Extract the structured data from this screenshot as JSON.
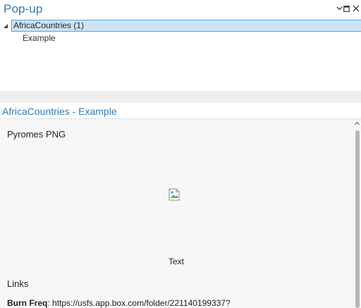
{
  "window": {
    "title": "Pop-up",
    "controls": {
      "dropdown_icon": "chevron-down-icon",
      "maximize_icon": "maximize-icon",
      "close_icon": "close-icon"
    }
  },
  "tree": {
    "parent": {
      "label": "AfricaCountries (1)",
      "expanded": true
    },
    "children": [
      {
        "label": "Example"
      }
    ]
  },
  "popup": {
    "title": "AfricaCountries - Example",
    "sections": {
      "image_heading": "Pyromes PNG",
      "image_icon": "broken-image-icon",
      "image_caption": "Text",
      "links_heading": "Links",
      "link": {
        "key": "Burn Freq",
        "separator": ": ",
        "value": "https://usfs.app.box.com/folder/221140199337?"
      }
    }
  },
  "colors": {
    "accent": "#2f7bbf",
    "selection_fill": "#cde4f7",
    "selection_border": "#5fa3dc",
    "content_bg": "#f7f7f7",
    "band_bg": "#efefef",
    "scroll_thumb": "#b6b6b6"
  }
}
